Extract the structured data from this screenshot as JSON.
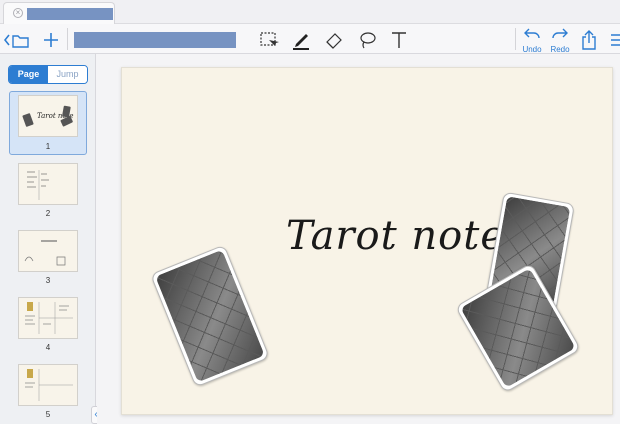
{
  "app": {
    "tab_close_symbol": "×"
  },
  "toolbar": {
    "undo_label": "Undo",
    "redo_label": "Redo"
  },
  "sidebar": {
    "segments": {
      "page_label": "Page",
      "jump_label": "Jump"
    },
    "pages": [
      {
        "number": "1",
        "selected": true
      },
      {
        "number": "2",
        "selected": false
      },
      {
        "number": "3",
        "selected": false
      },
      {
        "number": "4",
        "selected": false
      },
      {
        "number": "5",
        "selected": false
      }
    ],
    "collapse_symbol": "‹"
  },
  "document": {
    "title_text": "Tarot note",
    "page_color": "#f8f3e7"
  },
  "colors": {
    "accent": "#2d7dd2",
    "redacted": "#7793c2"
  },
  "icons": [
    "folder-back-icon",
    "add-icon",
    "lasso-select-icon",
    "pen-icon",
    "eraser-icon",
    "lasso-icon",
    "text-tool-icon",
    "undo-icon",
    "redo-icon",
    "share-icon",
    "menu-icon"
  ]
}
